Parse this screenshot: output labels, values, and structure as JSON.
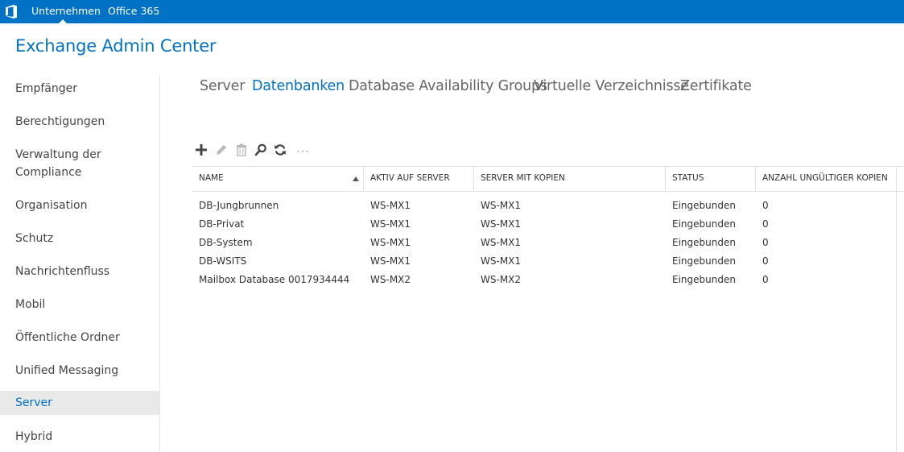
{
  "topbar": {
    "logo_icon": "office-logo-icon",
    "links": [
      "Unternehmen",
      "Office 365"
    ],
    "active_index": 0,
    "background": "#0072c6"
  },
  "app": {
    "title": "Exchange Admin Center",
    "accent": "#0072c6"
  },
  "sidebar": {
    "items": [
      {
        "label": "Empfänger"
      },
      {
        "label": "Berechtigungen"
      },
      {
        "label": "Verwaltung der Compliance"
      },
      {
        "label": "Organisation"
      },
      {
        "label": "Schutz"
      },
      {
        "label": "Nachrichtenfluss"
      },
      {
        "label": "Mobil"
      },
      {
        "label": "Öffentliche Ordner"
      },
      {
        "label": "Unified Messaging"
      },
      {
        "label": "Server"
      },
      {
        "label": "Hybrid"
      }
    ],
    "selected": "Server"
  },
  "tabs": {
    "items": [
      "Server",
      "Datenbanken",
      "Database Availability Groups",
      "Virtuelle Verzeichnisse",
      "Zertifikate"
    ],
    "active": "Datenbanken"
  },
  "toolbar": {
    "icons": [
      "add-icon",
      "edit-icon",
      "delete-icon",
      "search-icon",
      "refresh-icon",
      "more-icon"
    ]
  },
  "table": {
    "columns": [
      "NAME",
      "AKTIV AUF SERVER",
      "SERVER MIT KOPIEN",
      "STATUS",
      "ANZAHL UNGÜLTIGER KOPIEN"
    ],
    "sorted_column": "NAME",
    "sort_direction": "ascending",
    "rows": [
      [
        "DB-Jungbrunnen",
        "WS-MX1",
        "WS-MX1",
        "Eingebunden",
        "0"
      ],
      [
        "DB-Privat",
        "WS-MX1",
        "WS-MX1",
        "Eingebunden",
        "0"
      ],
      [
        "DB-System",
        "WS-MX1",
        "WS-MX1",
        "Eingebunden",
        "0"
      ],
      [
        "DB-WSITS",
        "WS-MX1",
        "WS-MX1",
        "Eingebunden",
        "0"
      ],
      [
        "Mailbox Database 0017934444",
        "WS-MX2",
        "WS-MX2",
        "Eingebunden",
        "0"
      ]
    ]
  }
}
